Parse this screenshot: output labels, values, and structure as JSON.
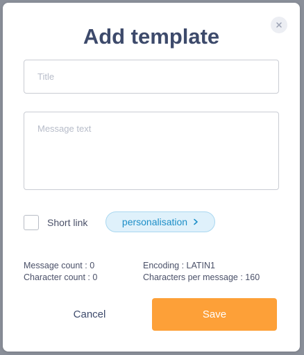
{
  "dialog": {
    "title": "Add template",
    "close_icon": "close-icon"
  },
  "form": {
    "title_placeholder": "Title",
    "title_value": "",
    "message_placeholder": "Message text",
    "message_value": "",
    "short_link": {
      "label": "Short link",
      "checked": false
    },
    "personalisation": {
      "label": "personalisation",
      "icon": "chevron-right-icon"
    }
  },
  "stats": {
    "message_count": "Message count : 0",
    "character_count": "Character count : 0",
    "encoding": "Encoding : LATIN1",
    "characters_per_message": "Characters per message : 160"
  },
  "actions": {
    "cancel_label": "Cancel",
    "save_label": "Save"
  },
  "colors": {
    "title": "#3d4a6b",
    "save_button": "#fda038",
    "personalisation_bg": "#dff1fb",
    "personalisation_text": "#1c8ec7"
  }
}
